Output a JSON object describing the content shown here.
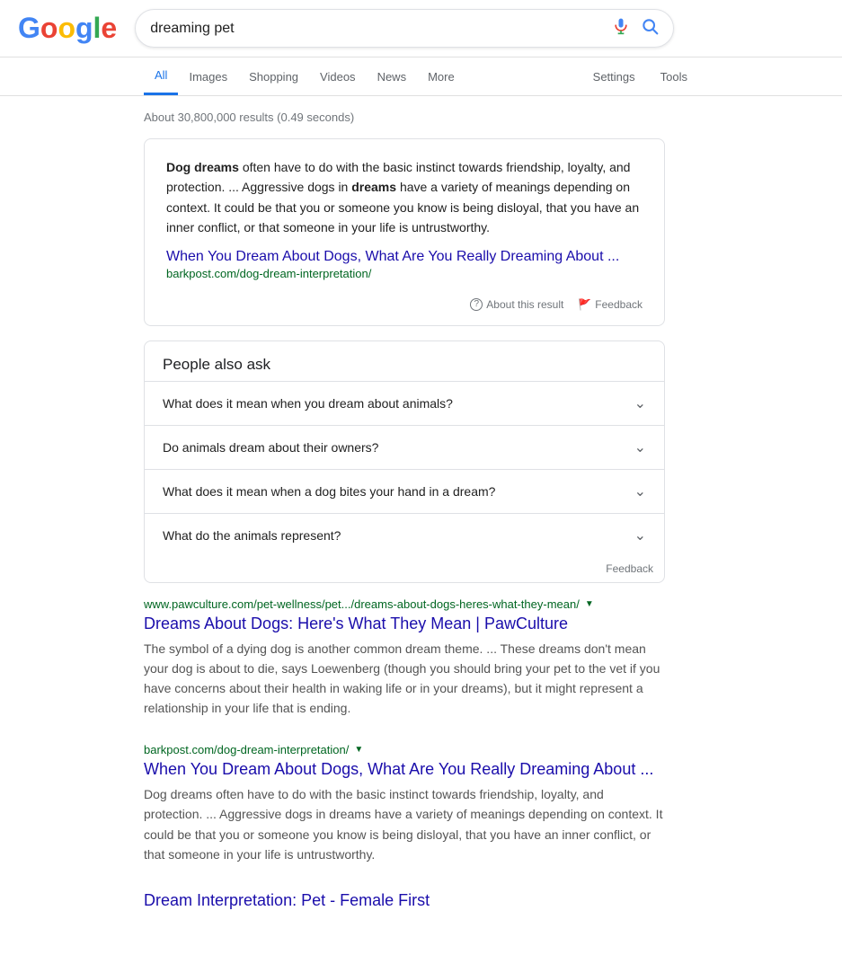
{
  "logo": {
    "letters": [
      {
        "char": "G",
        "color": "#4285f4"
      },
      {
        "char": "o",
        "color": "#ea4335"
      },
      {
        "char": "o",
        "color": "#fbbc05"
      },
      {
        "char": "g",
        "color": "#4285f4"
      },
      {
        "char": "l",
        "color": "#34a853"
      },
      {
        "char": "e",
        "color": "#ea4335"
      }
    ]
  },
  "search": {
    "query": "dreaming pet",
    "mic_label": "Search by voice",
    "search_label": "Google Search"
  },
  "nav": {
    "tabs": [
      {
        "label": "All",
        "active": true
      },
      {
        "label": "Images",
        "active": false
      },
      {
        "label": "Shopping",
        "active": false
      },
      {
        "label": "Videos",
        "active": false
      },
      {
        "label": "News",
        "active": false
      },
      {
        "label": "More",
        "active": false
      }
    ],
    "right_tabs": [
      {
        "label": "Settings"
      },
      {
        "label": "Tools"
      }
    ]
  },
  "results_count": "About 30,800,000 results (0.49 seconds)",
  "featured_snippet": {
    "text_parts": [
      {
        "text": "Dog dreams",
        "bold": true
      },
      {
        "text": " often have to do with the basic instinct towards friendship, loyalty, and protection. ... Aggressive dogs in ",
        "bold": false
      },
      {
        "text": "dreams",
        "bold": true
      },
      {
        "text": " have a variety of meanings depending on context. It could be that you or someone you know is being disloyal, that you have an inner conflict, or that someone in your life is untrustworthy.",
        "bold": false
      }
    ],
    "link_text": "When You Dream About Dogs, What Are You Really Dreaming About ...",
    "link_url": "barkpost.com/dog-dream-interpretation/",
    "about_label": "About this result",
    "feedback_label": "Feedback"
  },
  "people_also_ask": {
    "title": "People also ask",
    "questions": [
      "What does it mean when you dream about animals?",
      "Do animals dream about their owners?",
      "What does it mean when a dog bites your hand in a dream?",
      "What do the animals represent?"
    ],
    "feedback_label": "Feedback"
  },
  "results": [
    {
      "title": "Dreams About Dogs: Here's What They Mean | PawCulture",
      "url": "www.pawculture.com/pet-wellness/pet.../dreams-about-dogs-heres-what-they-mean/",
      "description": "The symbol of a dying dog is another common dream theme. ... These dreams don't mean your dog is about to die, says Loewenberg (though you should bring your pet to the vet if you have concerns about their health in waking life or in your dreams), but it might represent a relationship in your life that is ending."
    },
    {
      "title": "When You Dream About Dogs, What Are You Really Dreaming About ...",
      "url": "barkpost.com/dog-dream-interpretation/",
      "description": "Dog dreams often have to do with the basic instinct towards friendship, loyalty, and protection. ... Aggressive dogs in dreams have a variety of meanings depending on context. It could be that you or someone you know is being disloyal, that you have an inner conflict, or that someone in your life is untrustworthy."
    },
    {
      "title": "Dream Interpretation: Pet - Female First",
      "url": "",
      "description": ""
    }
  ]
}
